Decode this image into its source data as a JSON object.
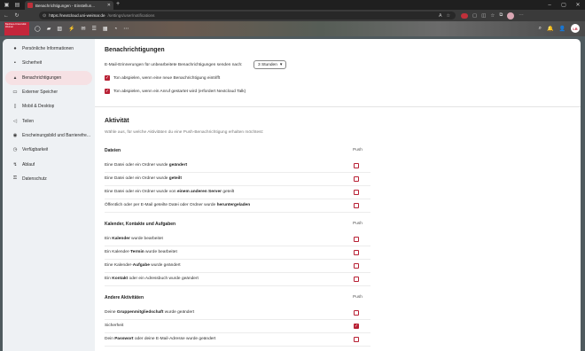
{
  "browser": {
    "tab_title": "Benachrichtigungen - Einstellun...",
    "url_host": "https://nextcloud.uni-weimar.de",
    "url_path": "/settings/user/notifications"
  },
  "header": {
    "logo_text": "Bauhaus-Universität Weimar",
    "avatar_initials": "LB"
  },
  "sidebar": {
    "items": [
      {
        "label": "Persönliche Informationen",
        "icon": "person-icon",
        "glyph": "●"
      },
      {
        "label": "Sicherheit",
        "icon": "lock-icon",
        "glyph": "🔒"
      },
      {
        "label": "Benachrichtigungen",
        "icon": "bell-icon",
        "glyph": "🔔"
      },
      {
        "label": "Externer Speicher",
        "icon": "storage-icon",
        "glyph": "▭"
      },
      {
        "label": "Mobil & Desktop",
        "icon": "phone-icon",
        "glyph": "▯"
      },
      {
        "label": "Teilen",
        "icon": "share-icon",
        "glyph": "◁"
      },
      {
        "label": "Erscheinungsbild und Barrierefre...",
        "icon": "palette-icon",
        "glyph": "◉"
      },
      {
        "label": "Verfügbarkeit",
        "icon": "clock-icon",
        "glyph": "◷"
      },
      {
        "label": "Ablauf",
        "icon": "flow-icon",
        "glyph": "⚡"
      },
      {
        "label": "Datenschutz",
        "icon": "key-icon",
        "glyph": "⚿"
      }
    ]
  },
  "notifications": {
    "title": "Benachrichtigungen",
    "email_label": "E-Mail-Erinnerungen für unbearbeitete Benachrichtigungen senden nach:",
    "email_value": "3 Stunden",
    "sound_notify_label": "Ton abspielen, wenn eine neue Benachrichtigung eintrifft",
    "sound_call_label": "Ton abspielen, wenn ein Anruf gestartet wird (erfordert Nextcloud Talk)"
  },
  "activity": {
    "title": "Aktivität",
    "description": "Wähle aus, für welche Aktivitäten du eine Push-Benachrichtigung erhalten möchtest:",
    "push_label": "Push",
    "groups": [
      {
        "name": "Dateien",
        "rows": [
          {
            "pre": "Eine Datei oder ein Ordner wurde ",
            "bold": "geändert",
            "post": "",
            "checked": false
          },
          {
            "pre": "Eine Datei oder ein Ordner wurde ",
            "bold": "geteilt",
            "post": "",
            "checked": false
          },
          {
            "pre": "Eine Datei oder ein Ordner wurde von ",
            "bold": "einem anderen Server",
            "post": " geteilt",
            "checked": false
          },
          {
            "pre": "Öffentlich oder per E-Mail geteilte Datei oder Ordner wurde ",
            "bold": "heruntergeladen",
            "post": "",
            "checked": false
          }
        ]
      },
      {
        "name": "Kalender, Kontakte und Aufgaben",
        "rows": [
          {
            "pre": "Ein ",
            "bold": "Kalender",
            "post": " wurde bearbeitet",
            "checked": false
          },
          {
            "pre": "Ein Kalender-",
            "bold": "Termin",
            "post": " wurde bearbeitet",
            "checked": false
          },
          {
            "pre": "Eine Kalender-",
            "bold": "Aufgabe",
            "post": " wurde geändert",
            "checked": false
          },
          {
            "pre": "Ein ",
            "bold": "Kontakt",
            "post": " oder ein Adressbuch wurde geändert",
            "checked": false
          }
        ]
      },
      {
        "name": "Andere Aktivitäten",
        "rows": [
          {
            "pre": "Deine ",
            "bold": "Gruppenmitgliedschaft",
            "post": " wurde geändert",
            "checked": false
          },
          {
            "pre": "Sicherheit",
            "bold": "",
            "post": "",
            "checked": true
          },
          {
            "pre": "Dein ",
            "bold": "Passwort",
            "post": " oder deine E-Mail-Adresse wurde geändert",
            "checked": false
          }
        ]
      }
    ]
  },
  "colors": {
    "accent": "#b82034",
    "sidebar_bg": "#eef1f4",
    "active_bg": "#f6e1e4"
  }
}
